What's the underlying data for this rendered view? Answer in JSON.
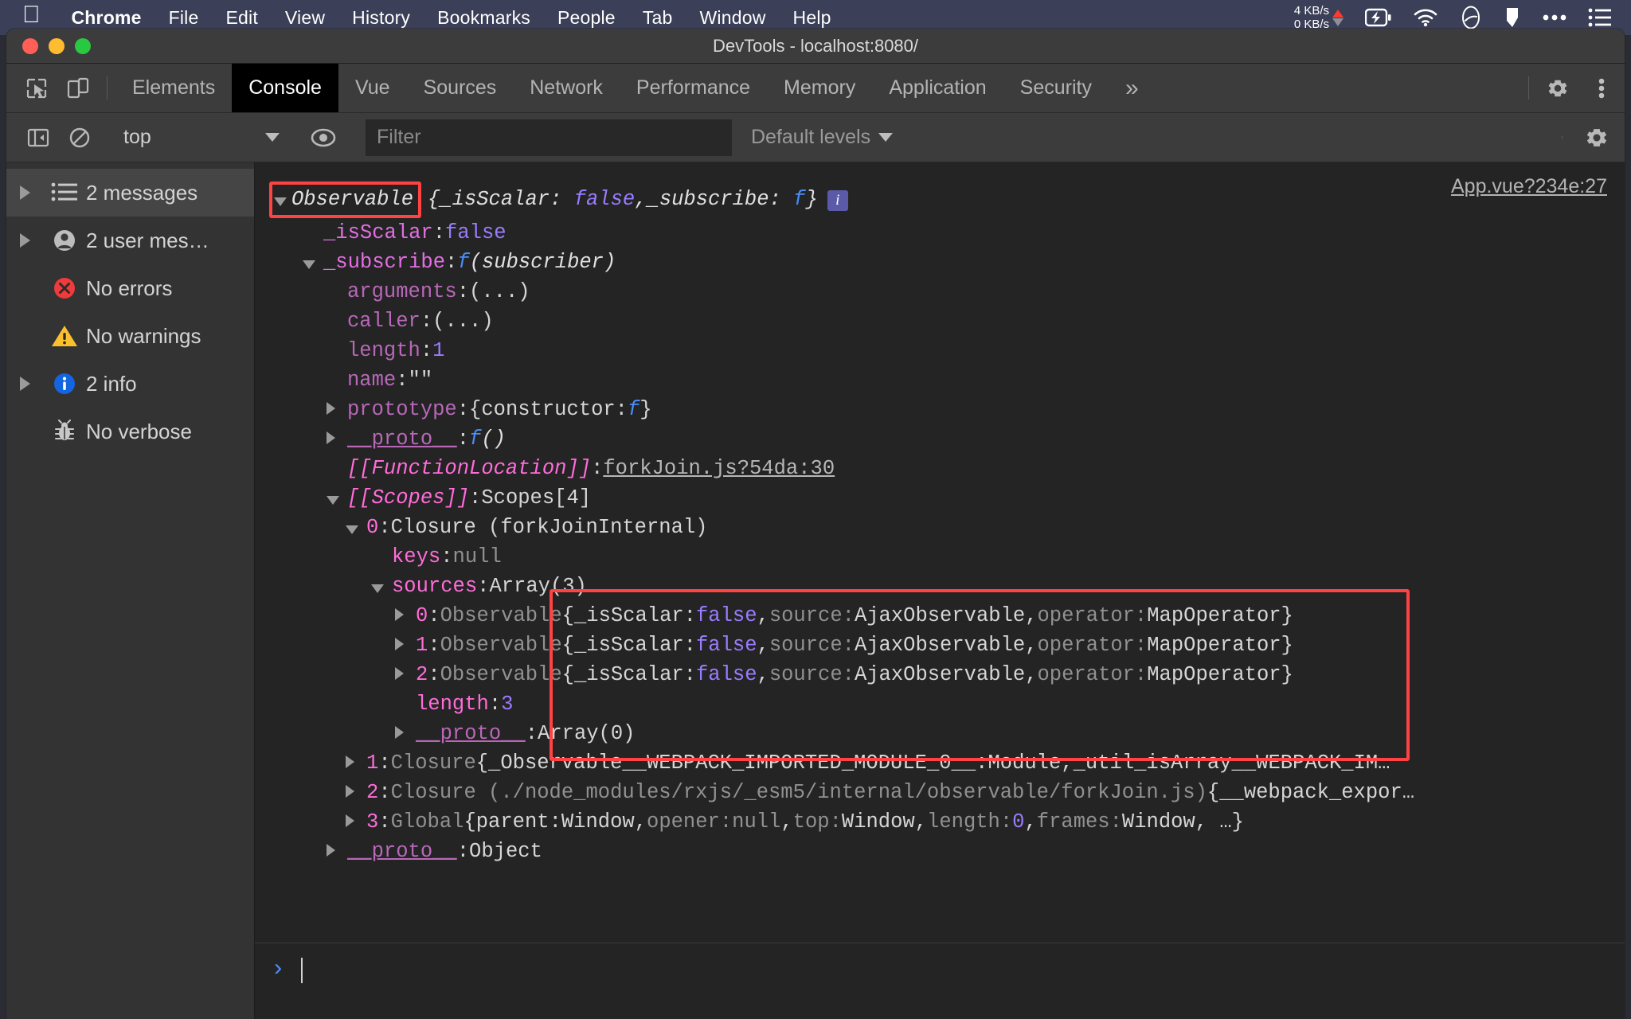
{
  "menubar": {
    "apple_glyph": "",
    "items": [
      {
        "label": "Chrome",
        "bold": true
      },
      {
        "label": "File",
        "bold": false
      },
      {
        "label": "Edit",
        "bold": false
      },
      {
        "label": "View",
        "bold": false
      },
      {
        "label": "History",
        "bold": false
      },
      {
        "label": "Bookmarks",
        "bold": false
      },
      {
        "label": "People",
        "bold": false
      },
      {
        "label": "Tab",
        "bold": false
      },
      {
        "label": "Window",
        "bold": false
      },
      {
        "label": "Help",
        "bold": false
      }
    ],
    "status": {
      "net_up": "4 KB/s",
      "net_down": "0 KB/s",
      "icons": [
        "battery-charging-icon",
        "wifi-icon",
        "siri-icon",
        "dropbox-icon",
        "ellipsis-icon",
        "control-center-icon"
      ]
    },
    "accent_bg": "#3b3f57"
  },
  "window": {
    "title": "DevTools - localhost:8080/",
    "traffic_lights": [
      "close",
      "minimize",
      "zoom"
    ]
  },
  "tabstrip": {
    "left_icons": [
      "inspect-element-icon",
      "device-toolbar-icon"
    ],
    "tabs": [
      {
        "label": "Elements",
        "active": false
      },
      {
        "label": "Console",
        "active": true
      },
      {
        "label": "Vue",
        "active": false
      },
      {
        "label": "Sources",
        "active": false
      },
      {
        "label": "Network",
        "active": false
      },
      {
        "label": "Performance",
        "active": false
      },
      {
        "label": "Memory",
        "active": false
      },
      {
        "label": "Application",
        "active": false
      },
      {
        "label": "Security",
        "active": false
      }
    ],
    "more_tabs_label": "»",
    "right_icons": [
      "settings-gear-icon",
      "more-options-icon"
    ]
  },
  "console_toolbar": {
    "sidebar_toggle_icon": "show-console-sidebar-icon",
    "clear_icon": "clear-console-icon",
    "context": "top",
    "eye_icon": "live-expression-icon",
    "filter_placeholder": "Filter",
    "filter_value": "",
    "levels_label": "Default levels",
    "settings_icon": "settings-gear-icon"
  },
  "sidebar": {
    "items": [
      {
        "label": "2 messages",
        "icon": "list-icon",
        "expandable": true,
        "selected": true
      },
      {
        "label": "2 user mes…",
        "icon": "person-icon",
        "expandable": true,
        "selected": false
      },
      {
        "label": "No errors",
        "icon": "error-icon",
        "expandable": false,
        "selected": false
      },
      {
        "label": "No warnings",
        "icon": "warning-icon",
        "expandable": false,
        "selected": false
      },
      {
        "label": "2 info",
        "icon": "info-icon",
        "expandable": true,
        "selected": false
      },
      {
        "label": "No verbose",
        "icon": "bug-icon",
        "expandable": false,
        "selected": false
      }
    ]
  },
  "console": {
    "source_link": "App.vue?234e:27",
    "header": {
      "name": "Observable",
      "preview_open": "{",
      "prop1": "_isScalar",
      "val1": "false",
      "sep": ", ",
      "prop2": "_subscribe",
      "val2": "f",
      "preview_close": "}",
      "info_badge": "i",
      "highlighted": true
    },
    "lines": [
      {
        "id": "isScalar",
        "indent": 1,
        "twisty": "none",
        "parts": [
          {
            "t": "_isScalar",
            "c": "c-name"
          },
          {
            "t": ": ",
            "c": "c-txt"
          },
          {
            "t": "false",
            "c": "c-val"
          }
        ]
      },
      {
        "id": "subscribe",
        "indent": 1,
        "twisty": "open",
        "parts": [
          {
            "t": "_subscribe",
            "c": "c-name"
          },
          {
            "t": ": ",
            "c": "c-txt"
          },
          {
            "t": "f",
            "c": "c-fn"
          },
          {
            "t": " (subscriber)",
            "c": "c-hdr"
          }
        ]
      },
      {
        "id": "arguments",
        "indent": 2,
        "twisty": "none",
        "parts": [
          {
            "t": "arguments",
            "c": "c-name-d"
          },
          {
            "t": ": ",
            "c": "c-txt"
          },
          {
            "t": "(...)",
            "c": "c-txt"
          }
        ]
      },
      {
        "id": "caller",
        "indent": 2,
        "twisty": "none",
        "parts": [
          {
            "t": "caller",
            "c": "c-name-d"
          },
          {
            "t": ": ",
            "c": "c-txt"
          },
          {
            "t": "(...)",
            "c": "c-txt"
          }
        ]
      },
      {
        "id": "length1",
        "indent": 2,
        "twisty": "none",
        "parts": [
          {
            "t": "length",
            "c": "c-name-d"
          },
          {
            "t": ": ",
            "c": "c-txt"
          },
          {
            "t": "1",
            "c": "c-val"
          }
        ]
      },
      {
        "id": "name",
        "indent": 2,
        "twisty": "none",
        "parts": [
          {
            "t": "name",
            "c": "c-name-d"
          },
          {
            "t": ": ",
            "c": "c-txt"
          },
          {
            "t": "\"\"",
            "c": "c-str"
          }
        ]
      },
      {
        "id": "prototype",
        "indent": 2,
        "twisty": "closed",
        "parts": [
          {
            "t": "prototype",
            "c": "c-name-d"
          },
          {
            "t": ": ",
            "c": "c-txt"
          },
          {
            "t": "{constructor: ",
            "c": "c-txt"
          },
          {
            "t": "f",
            "c": "c-fn"
          },
          {
            "t": "}",
            "c": "c-txt"
          }
        ]
      },
      {
        "id": "proto1",
        "indent": 2,
        "twisty": "closed",
        "parts": [
          {
            "t": "__proto__",
            "c": "c-name-d underline"
          },
          {
            "t": ": ",
            "c": "c-txt"
          },
          {
            "t": "f",
            "c": "c-fn"
          },
          {
            "t": " ()",
            "c": "c-hdr"
          }
        ]
      },
      {
        "id": "funcloc",
        "indent": 2,
        "twisty": "none",
        "parts": [
          {
            "t": "[[FunctionLocation]]",
            "c": "c-ital"
          },
          {
            "t": ": ",
            "c": "c-txt"
          },
          {
            "t": "forkJoin.js?54da:30",
            "c": "c-link"
          }
        ]
      },
      {
        "id": "scopes",
        "indent": 2,
        "twisty": "open",
        "parts": [
          {
            "t": "[[Scopes]]",
            "c": "c-ital"
          },
          {
            "t": ": ",
            "c": "c-txt"
          },
          {
            "t": "Scopes[4]",
            "c": "c-txt"
          }
        ]
      },
      {
        "id": "scope0",
        "indent": 3,
        "twisty": "open",
        "parts": [
          {
            "t": "0",
            "c": "c-idx"
          },
          {
            "t": ": ",
            "c": "c-txt"
          },
          {
            "t": "Closure (forkJoinInternal)",
            "c": "c-txt"
          }
        ]
      },
      {
        "id": "keys",
        "indent": 4,
        "twisty": "none",
        "parts": [
          {
            "t": "keys",
            "c": "c-int"
          },
          {
            "t": ": ",
            "c": "c-txt"
          },
          {
            "t": "null",
            "c": "c-dim"
          }
        ]
      },
      {
        "id": "sources",
        "indent": 4,
        "twisty": "open",
        "parts": [
          {
            "t": "sources",
            "c": "c-int"
          },
          {
            "t": ": ",
            "c": "c-txt"
          },
          {
            "t": "Array(3)",
            "c": "c-txt"
          }
        ]
      },
      {
        "id": "src0",
        "indent": 5,
        "twisty": "closed",
        "parts": [
          {
            "t": "0",
            "c": "c-idx"
          },
          {
            "t": ": ",
            "c": "c-txt"
          },
          {
            "t": "Observable ",
            "c": "c-dim"
          },
          {
            "t": "{_isScalar: ",
            "c": "c-txt"
          },
          {
            "t": "false",
            "c": "c-val"
          },
          {
            "t": ", ",
            "c": "c-txt"
          },
          {
            "t": "source: ",
            "c": "c-dim"
          },
          {
            "t": "AjaxObservable",
            "c": "c-txt"
          },
          {
            "t": ", ",
            "c": "c-txt"
          },
          {
            "t": "operator: ",
            "c": "c-dim"
          },
          {
            "t": "MapOperator}",
            "c": "c-txt"
          }
        ]
      },
      {
        "id": "src1",
        "indent": 5,
        "twisty": "closed",
        "parts": [
          {
            "t": "1",
            "c": "c-idx"
          },
          {
            "t": ": ",
            "c": "c-txt"
          },
          {
            "t": "Observable ",
            "c": "c-dim"
          },
          {
            "t": "{_isScalar: ",
            "c": "c-txt"
          },
          {
            "t": "false",
            "c": "c-val"
          },
          {
            "t": ", ",
            "c": "c-txt"
          },
          {
            "t": "source: ",
            "c": "c-dim"
          },
          {
            "t": "AjaxObservable",
            "c": "c-txt"
          },
          {
            "t": ", ",
            "c": "c-txt"
          },
          {
            "t": "operator: ",
            "c": "c-dim"
          },
          {
            "t": "MapOperator}",
            "c": "c-txt"
          }
        ]
      },
      {
        "id": "src2",
        "indent": 5,
        "twisty": "closed",
        "parts": [
          {
            "t": "2",
            "c": "c-idx"
          },
          {
            "t": ": ",
            "c": "c-txt"
          },
          {
            "t": "Observable ",
            "c": "c-dim"
          },
          {
            "t": "{_isScalar: ",
            "c": "c-txt"
          },
          {
            "t": "false",
            "c": "c-val"
          },
          {
            "t": ", ",
            "c": "c-txt"
          },
          {
            "t": "source: ",
            "c": "c-dim"
          },
          {
            "t": "AjaxObservable",
            "c": "c-txt"
          },
          {
            "t": ", ",
            "c": "c-txt"
          },
          {
            "t": "operator: ",
            "c": "c-dim"
          },
          {
            "t": "MapOperator}",
            "c": "c-txt"
          }
        ]
      },
      {
        "id": "length3",
        "indent": 5,
        "twisty": "none",
        "parts": [
          {
            "t": "length",
            "c": "c-int"
          },
          {
            "t": ": ",
            "c": "c-txt"
          },
          {
            "t": "3",
            "c": "c-val"
          }
        ]
      },
      {
        "id": "proto2",
        "indent": 5,
        "twisty": "closed",
        "parts": [
          {
            "t": "__proto__",
            "c": "c-name-d underline"
          },
          {
            "t": ": ",
            "c": "c-txt"
          },
          {
            "t": "Array(0)",
            "c": "c-txt"
          }
        ]
      },
      {
        "id": "scope1",
        "indent": 3,
        "twisty": "closed",
        "parts": [
          {
            "t": "1",
            "c": "c-idx"
          },
          {
            "t": ": ",
            "c": "c-txt"
          },
          {
            "t": "Closure ",
            "c": "c-dim"
          },
          {
            "t": "{_Observable__WEBPACK_IMPORTED_MODULE_0__: ",
            "c": "c-txt"
          },
          {
            "t": "Module",
            "c": "c-txt"
          },
          {
            "t": ", ",
            "c": "c-txt"
          },
          {
            "t": "_util_isArray__WEBPACK_IM…",
            "c": "c-txt"
          }
        ]
      },
      {
        "id": "scope2",
        "indent": 3,
        "twisty": "closed",
        "parts": [
          {
            "t": "2",
            "c": "c-idx"
          },
          {
            "t": ": ",
            "c": "c-txt"
          },
          {
            "t": "Closure (./node_modules/rxjs/_esm5/internal/observable/forkJoin.js) ",
            "c": "c-dim"
          },
          {
            "t": "{__webpack_expor…",
            "c": "c-txt"
          }
        ]
      },
      {
        "id": "scope3",
        "indent": 3,
        "twisty": "closed",
        "parts": [
          {
            "t": "3",
            "c": "c-idx"
          },
          {
            "t": ": ",
            "c": "c-txt"
          },
          {
            "t": "Global ",
            "c": "c-dim"
          },
          {
            "t": "{parent: ",
            "c": "c-txt"
          },
          {
            "t": "Window",
            "c": "c-txt"
          },
          {
            "t": ", ",
            "c": "c-txt"
          },
          {
            "t": "opener: ",
            "c": "c-dim"
          },
          {
            "t": "null",
            "c": "c-dim"
          },
          {
            "t": ", ",
            "c": "c-txt"
          },
          {
            "t": "top: ",
            "c": "c-dim"
          },
          {
            "t": "Window",
            "c": "c-txt"
          },
          {
            "t": ", ",
            "c": "c-txt"
          },
          {
            "t": "length: ",
            "c": "c-dim"
          },
          {
            "t": "0",
            "c": "c-val"
          },
          {
            "t": ", ",
            "c": "c-txt"
          },
          {
            "t": "frames: ",
            "c": "c-dim"
          },
          {
            "t": "Window",
            "c": "c-txt"
          },
          {
            "t": ", …}",
            "c": "c-txt"
          }
        ]
      },
      {
        "id": "proto3",
        "indent": 2,
        "twisty": "closed",
        "parts": [
          {
            "t": "__proto__",
            "c": "c-name-d underline"
          },
          {
            "t": ": ",
            "c": "c-txt"
          },
          {
            "t": "Object",
            "c": "c-txt"
          }
        ]
      }
    ],
    "prompt_chevron": "›"
  },
  "colors": {
    "menubar_bg": "#3b3f57",
    "devtools_bg": "#242424",
    "toolbar_bg": "#3c3c3c",
    "sidebar_bg": "#333333",
    "active_tab_bg": "#000000",
    "highlight_red": "#ff4242",
    "link_blue": "#4a8df8",
    "prop_pink": "#e36fe3",
    "value_purple": "#9a7cff"
  }
}
